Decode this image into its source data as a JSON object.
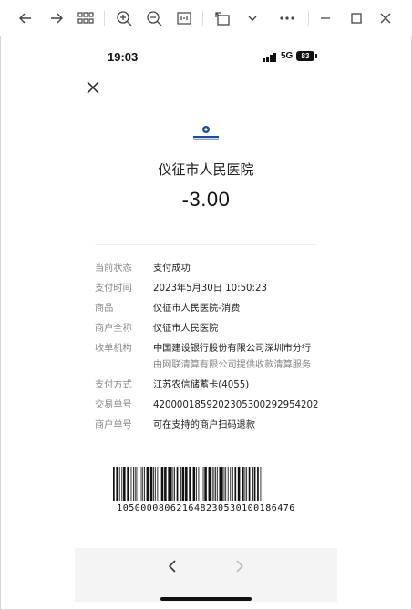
{
  "status_bar": {
    "time": "19:03",
    "network": "5G",
    "battery": "83"
  },
  "merchant": {
    "name": "仪征市人民医院",
    "amount": "-3.00"
  },
  "details": [
    {
      "label": "当前状态",
      "value": "支付成功"
    },
    {
      "label": "支付时间",
      "value": "2023年5月30日 10:50:23"
    },
    {
      "label": "商品",
      "value": "仪征市人民医院-消费"
    },
    {
      "label": "商户全称",
      "value": "仪征市人民医院"
    },
    {
      "label": "收单机构",
      "value": "中国建设银行股份有限公司深圳市分行",
      "sub": "由网联清算有限公司提供收款清算服务"
    },
    {
      "label": "支付方式",
      "value": "江苏农信储蓄卡(4055)"
    },
    {
      "label": "交易单号",
      "value": "4200001859202305300292954202"
    },
    {
      "label": "商户单号",
      "value": "可在支持的商户扫码退款"
    }
  ],
  "barcode": {
    "number": "105000080621648230530100186476"
  },
  "icons": {
    "toolbar": [
      "back-arrow-icon",
      "forward-arrow-icon",
      "grid-icon",
      "zoom-in-icon",
      "zoom-out-icon",
      "fit-page-icon",
      "rotate-icon",
      "chevron-down-icon",
      "more-icon",
      "minimize-icon",
      "maximize-icon",
      "close-window-icon"
    ],
    "close": "close-icon",
    "nav_back": "chevron-left-icon",
    "nav_forward": "chevron-right-icon"
  },
  "colors": {
    "bank_logo": "#1b4f9c"
  }
}
